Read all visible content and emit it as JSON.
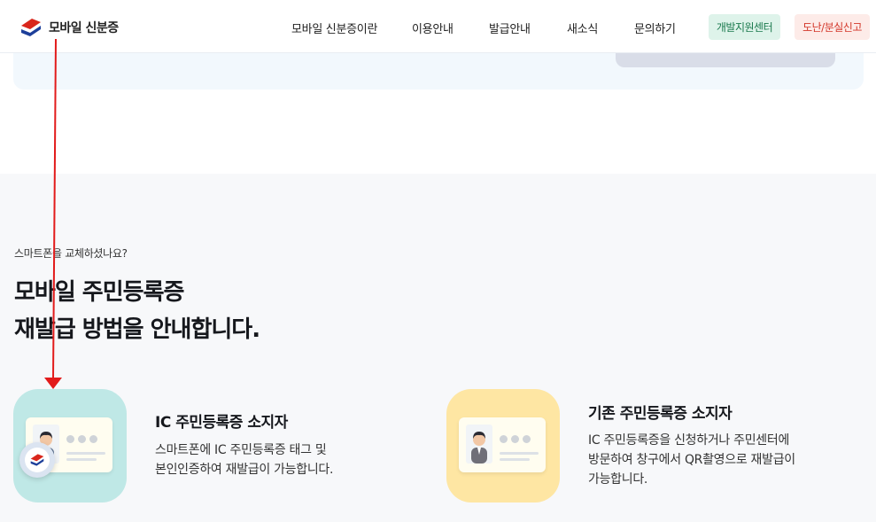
{
  "header": {
    "logo_text": "모바일 신분증",
    "nav": [
      "모바일 신분증이란",
      "이용안내",
      "발급안내",
      "새소식",
      "문의하기"
    ],
    "dev_center_label": "개발지원센터",
    "lost_report_label": "도난/분실신고"
  },
  "section": {
    "eyebrow": "스마트폰을 교체하셨나요?",
    "title_line1": "모바일 주민등록증",
    "title_line2": "재발급 방법을 안내합니다.",
    "cards": [
      {
        "title": "IC 주민등록증 소지자",
        "desc_line1": "스마트폰에 IC 주민등록증 태그 및",
        "desc_line2": "본인인증하여 재발급이 가능합니다."
      },
      {
        "title": "기존 주민등록증 소지자",
        "desc_line1": "IC 주민등록증을 신청하거나 주민센터에",
        "desc_line2": "방문하여 창구에서 QR촬영으로 재발급이",
        "desc_line3": "가능합니다."
      }
    ]
  },
  "colors": {
    "brand_red": "#d9261c",
    "brand_blue": "#1d3f9a",
    "dev_green": "#1b7a4e",
    "lost_red": "#d3372a",
    "ic_card_bg": "#bfe8e6",
    "old_card_bg": "#fee6a3",
    "annotation_arrow": "#e21b1b"
  },
  "icons": [
    "logo-icon",
    "id-card-icon",
    "app-badge-icon"
  ]
}
